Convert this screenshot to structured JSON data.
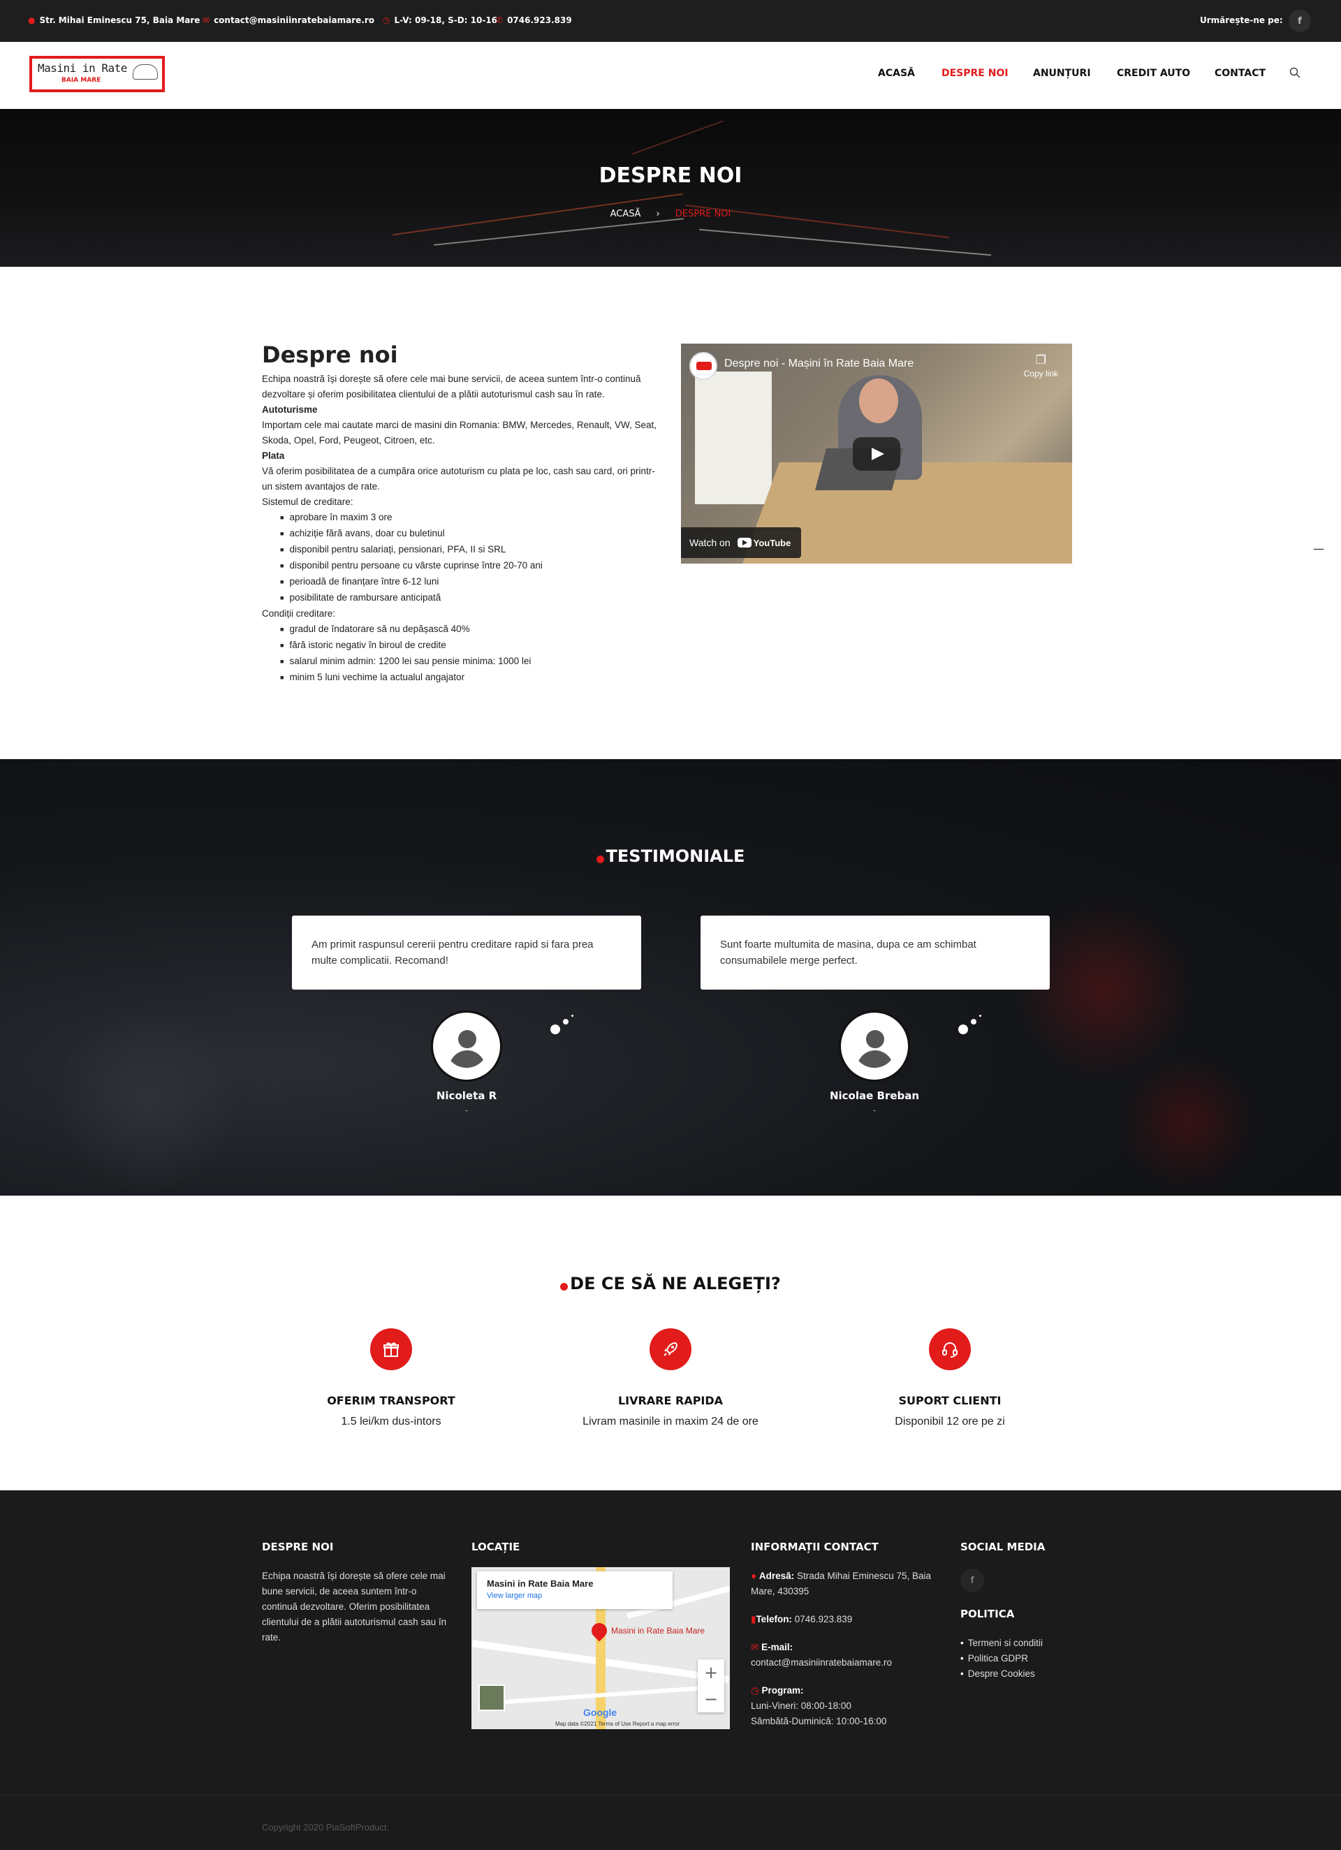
{
  "topbar": {
    "address": "Str. Mihai Eminescu 75, Baia Mare",
    "email": "contact@masiniinratebaiamare.ro",
    "hours": "L-V: 09-18, S-D: 10-16",
    "phone": "0746.923.839",
    "follow_label": "Urmărește-ne pe:",
    "social_icon": "f"
  },
  "logo": {
    "line1": "Masini in Rate",
    "line2": "BAIA MARE"
  },
  "nav": {
    "items": [
      "ACASĂ",
      "DESPRE NOI",
      "ANUNȚURI",
      "CREDIT AUTO",
      "CONTACT"
    ],
    "active": "DESPRE NOI"
  },
  "hero": {
    "title": "DESPRE NOI",
    "breadcrumb_home": "ACASĂ",
    "breadcrumb_sep": "›",
    "breadcrumb_current": "DESPRE NOI"
  },
  "about": {
    "heading": "Despre noi",
    "intro": "Echipa noastră își dorește să ofere cele mai bune servicii, de aceea suntem într-o continuă dezvoltare și oferim posibilitatea  clientului de a plătii autoturismul cash sau în rate.",
    "cars_title": "Autoturisme",
    "cars_text": "Importam cele mai cautate marci de masini din Romania: BMW, Mercedes, Renault, VW, Seat, Skoda, Opel, Ford, Peugeot, Citroen, etc.",
    "pay_title": "Plata",
    "pay_text": "Vă oferim posibilitatea de a cumpăra orice autoturism cu plata pe loc, cash sau card, ori printr-un sistem avantajos de rate.",
    "credit_system_title": "Sistemul de creditare:",
    "credit_system": [
      "aprobare în maxim 3 ore",
      "achiziție fără avans, doar cu buletinul",
      "disponibil pentru salariați, pensionari, PFA, II si SRL",
      "disponibil pentru persoane cu vârste cuprinse între 20-70 ani",
      "perioadă de finanțare între 6-12 luni",
      "posibilitate de rambursare anticipată"
    ],
    "credit_conditions_title": "Condiții creditare:",
    "credit_conditions": [
      "gradul de îndatorare să nu depășască 40%",
      "fără istoric negativ în biroul de credite",
      "salarul minim admin: 1200 lei sau pensie minima: 1000 lei",
      "minim 5 luni vechime la actualul angajator"
    ]
  },
  "video": {
    "title": "Despre noi - Mașini în Rate Baia Mare",
    "copy_link": "Copy link",
    "watch_on": "Watch on",
    "youtube": "YouTube"
  },
  "testimonials": {
    "title": "TESTIMONIALE",
    "items": [
      {
        "text": "Am primit raspunsul cererii pentru creditare rapid si fara prea multe complicatii. Recomand!",
        "name": "Nicoleta R",
        "role": "-"
      },
      {
        "text": "Sunt foarte multumita de masina, dupa ce am schimbat consumabilele merge perfect.",
        "name": "Nicolae Breban",
        "role": "-"
      }
    ]
  },
  "why": {
    "title": "DE CE SĂ NE ALEGEȚI?",
    "features": [
      {
        "icon": "gift-icon",
        "glyph": "🎁",
        "title": "OFERIM TRANSPORT",
        "text": "1.5 lei/km dus-intors"
      },
      {
        "icon": "rocket-icon",
        "glyph": "🚀",
        "title": "LIVRARE RAPIDA",
        "text": "Livram masinile in maxim 24 de ore"
      },
      {
        "icon": "headset-icon",
        "glyph": "🎧",
        "title": "SUPORT CLIENTI",
        "text": "Disponibil 12 ore pe zi"
      }
    ]
  },
  "footer": {
    "about_title": "DESPRE NOI",
    "about_text": "Echipa noastră își dorește să ofere cele mai bune servicii, de aceea suntem într-o continuă dezvoltare. Oferim posibilitatea clientului de a plătii autoturismul cash sau în rate.",
    "location_title": "LOCAȚIE",
    "map": {
      "place": "Masini in Rate Baia Mare",
      "larger": "View larger map",
      "pin_label": "Masini in Rate Baia Mare",
      "google": "Google",
      "attribution": "Map data ©2021    Terms of Use    Report a map error"
    },
    "contact_title": "INFORMAȚII CONTACT",
    "address_label": "Adresă:",
    "address": "Strada Mihai Eminescu 75, Baia Mare, 430395",
    "phone_label": "Telefon:",
    "phone": "0746.923.839",
    "email_label": "E-mail:",
    "email": "contact@masiniinratebaiamare.ro",
    "program_label": "Program:",
    "program_week": "Luni-Vineri: 08:00-18:00",
    "program_weekend": "Sâmbătă-Duminică: 10:00-16:00",
    "social_title": "SOCIAL MEDIA",
    "social_icon": "f",
    "policy_title": "POLITICA",
    "policy_links": [
      "Termeni si conditii",
      "Politica GDPR",
      "Despre Cookies"
    ],
    "copyright": "Copyright 2020 PiaSoftProduct."
  },
  "colors": {
    "accent": "#e21b1b",
    "topbar_bg": "#1e1e1e",
    "footer_bg": "#1b1b1b"
  }
}
